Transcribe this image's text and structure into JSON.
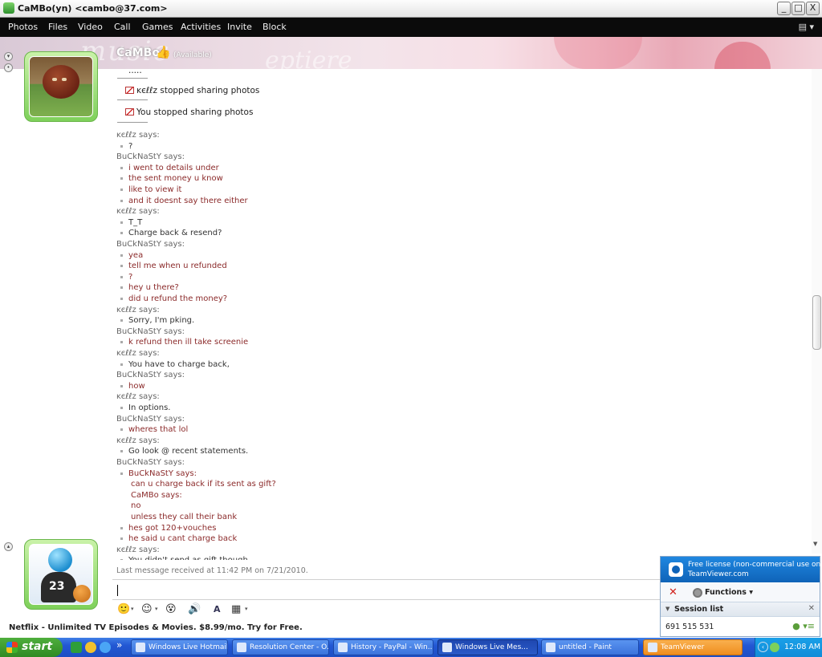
{
  "window": {
    "title": "CaMBo(yn) <cambo@37.com>",
    "minimize_glyph": "_",
    "maximize_glyph": "□",
    "close_glyph": "X"
  },
  "menu": {
    "items": [
      "Photos",
      "Files",
      "Video",
      "Call",
      "Games",
      "Activities",
      "Invite",
      "Block"
    ]
  },
  "contact": {
    "name": "CaMBo",
    "status": "(Available)"
  },
  "notices": [
    {
      "text": "....."
    },
    {
      "text": "ĸєℓℓz stopped sharing photos"
    },
    {
      "text": "You stopped sharing photos"
    }
  ],
  "chat": [
    {
      "kind": "says",
      "text": "ĸєℓℓz says:"
    },
    {
      "kind": "self",
      "text": "?"
    },
    {
      "kind": "says",
      "text": "BuCkNaStY says:"
    },
    {
      "kind": "other",
      "text": "i went to details under"
    },
    {
      "kind": "other",
      "text": "the sent money u know"
    },
    {
      "kind": "other",
      "text": "like to view it"
    },
    {
      "kind": "other",
      "text": "and it doesnt say there either"
    },
    {
      "kind": "says",
      "text": "ĸєℓℓz says:"
    },
    {
      "kind": "self",
      "text": "T_T"
    },
    {
      "kind": "self",
      "text": "Charge back & resend?"
    },
    {
      "kind": "says",
      "text": "BuCkNaStY says:"
    },
    {
      "kind": "other",
      "text": "yea"
    },
    {
      "kind": "other",
      "text": "tell me when u refunded"
    },
    {
      "kind": "other",
      "text": "?"
    },
    {
      "kind": "other",
      "text": "hey u there?"
    },
    {
      "kind": "other",
      "text": "did u refund the money?"
    },
    {
      "kind": "says",
      "text": "ĸєℓℓz says:"
    },
    {
      "kind": "self",
      "text": "Sorry, I'm pking."
    },
    {
      "kind": "says",
      "text": "BuCkNaStY says:"
    },
    {
      "kind": "other",
      "text": "k refund then ill take screenie"
    },
    {
      "kind": "says",
      "text": "ĸєℓℓz says:"
    },
    {
      "kind": "self",
      "text": "You have to charge back,"
    },
    {
      "kind": "says",
      "text": "BuCkNaStY says:"
    },
    {
      "kind": "other",
      "text": "how"
    },
    {
      "kind": "says",
      "text": "ĸєℓℓz says:"
    },
    {
      "kind": "self",
      "text": "In options."
    },
    {
      "kind": "says",
      "text": "BuCkNaStY says:"
    },
    {
      "kind": "other",
      "text": "wheres that lol"
    },
    {
      "kind": "says",
      "text": "ĸєℓℓz says:"
    },
    {
      "kind": "self",
      "text": "Go look @ recent statements."
    },
    {
      "kind": "says",
      "text": "BuCkNaStY says:"
    },
    {
      "kind": "other",
      "text": "BuCkNaStY says:"
    },
    {
      "kind": "quoted",
      "text": "can u charge back if its sent as gift?"
    },
    {
      "kind": "quoted",
      "text": "CaMBo  says:"
    },
    {
      "kind": "quoted",
      "text": "no"
    },
    {
      "kind": "quoted",
      "text": "unless they call their bank"
    },
    {
      "kind": "other",
      "text": "hes got 120+vouches"
    },
    {
      "kind": "other",
      "text": "he said u cant charge back"
    },
    {
      "kind": "says",
      "text": "ĸєℓℓz says:"
    },
    {
      "kind": "self",
      "text": "You didn't send as gift though."
    }
  ],
  "last_message": "Last message received at 11:42 PM on 7/21/2010.",
  "toolbar_icons": [
    "smiley-icon",
    "wink-icon",
    "nudge-icon",
    "voice-clip-icon",
    "font-icon",
    "background-icon"
  ],
  "ad": {
    "text": "Netflix - Unlimited TV Episodes & Movies. $8.99/mo. Try for Free."
  },
  "teamviewer": {
    "license_line1": "Free license (non-commercial use only)",
    "license_line2": "TeamViewer.com",
    "functions_label": "Functions",
    "session_list_label": "Session list",
    "session_id": "691 515 531"
  },
  "taskbar": {
    "start_label": "start",
    "tasks": [
      {
        "label": "Windows Live Hotmail..."
      },
      {
        "label": "Resolution Center - O..."
      },
      {
        "label": "History - PayPal - Win..."
      },
      {
        "label": "Windows Live Mes..."
      },
      {
        "label": "untitled - Paint"
      },
      {
        "label": "TeamViewer"
      }
    ],
    "clock": "12:08 AM"
  },
  "colors": {
    "other_user_text": "#8b2a2a",
    "self_text": "#333333",
    "menubar": "#0b0b0b",
    "taskbar": "#2257d3",
    "teamviewer_blue": "#1f87e0"
  }
}
